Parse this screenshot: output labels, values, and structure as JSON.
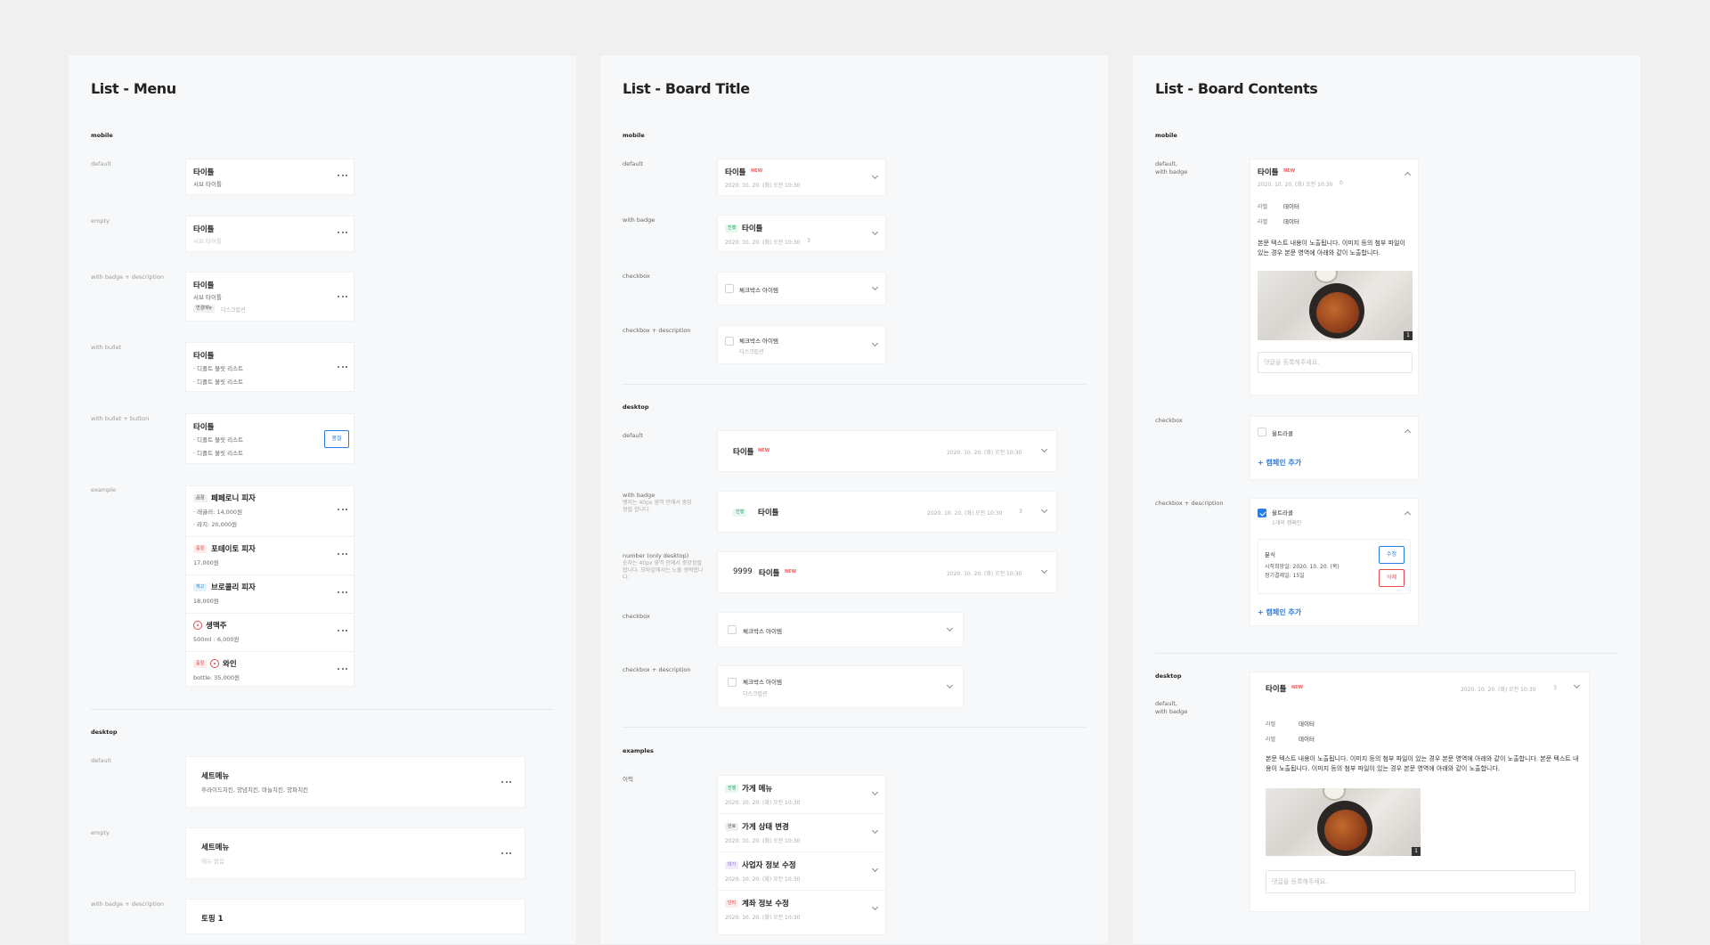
{
  "panels": {
    "menu": {
      "title": "List - Menu",
      "mobile": "mobile",
      "desktop": "desktop",
      "labels": [
        "default",
        "empty",
        "with badge + description",
        "with bullet",
        "with bullet + button",
        "example"
      ],
      "desktop_labels": [
        "default",
        "empty",
        "with badge + description"
      ],
      "title_text": "타이틀",
      "subtitle": "서브 타이틀",
      "badge_desc_badge": "연결메뉴",
      "badge_desc_desc": "디스크립션",
      "bullet1": "· 디폴트 불릿 리스트",
      "bullet2": "· 디폴트 불릿 리스트",
      "button": "품절",
      "example": [
        {
          "badge": "品절",
          "name": "페페로니 피자",
          "lines": [
            "· 레귤러: 14,000원",
            "· 라지: 20,000원"
          ]
        },
        {
          "badge": "품절",
          "name": "포테이토 피자",
          "lines": [
            "17,000원"
          ]
        },
        {
          "badge": "재고",
          "name": "브로콜리 피자",
          "lines": [
            "18,000원"
          ]
        },
        {
          "badge": "",
          "name": "생맥주",
          "lines": [
            "500ml : 6,000원"
          ]
        },
        {
          "badge": "품절",
          "name": "와인",
          "lines": [
            "bottle: 35,000원"
          ]
        }
      ],
      "desk_default_title": "세트메뉴",
      "desk_default_sub": "후라이드치킨, 양념치킨, 마늘치킨, 양파치킨",
      "desk_empty_title": "세트메뉴",
      "desk_empty_sub": "메뉴 없음",
      "desk_badge_title": "토핑 1"
    },
    "board_title": {
      "title": "List - Board Title",
      "mobile": "mobile",
      "desktop": "desktop",
      "examples": "examples",
      "labels": [
        "default",
        "with badge",
        "checkbox",
        "checkbox + description"
      ],
      "desktop_labels": [
        "default",
        "with badge",
        "number (only desktop)",
        "checkbox",
        "checkbox + description"
      ],
      "with_badge_note": "뱃지는 40px 영역 안에서 중앙정렬 합니다.",
      "number_note": "숫자는 40px 영역 안에서 중앙정렬 합니다. 모바일에서는 노출 생략합니다.",
      "history_label": "이력",
      "title_text": "타이틀",
      "new": "NEW",
      "date": "2020. 10. 20. (화) 오전 10:30",
      "comments": "0",
      "comments3": "3",
      "badge_progress": "진행",
      "checkbox_item": "체크박스 아이템",
      "checkbox_desc": "디스크립션",
      "number": "9999",
      "history": [
        {
          "badge": "진행",
          "badge_color": "green",
          "title": "가게 메뉴"
        },
        {
          "badge": "완료",
          "badge_color": "gray",
          "title": "가게 상태 변경"
        },
        {
          "badge": "대기",
          "badge_color": "purple",
          "title": "사업자 정보 수정"
        },
        {
          "badge": "반려",
          "badge_color": "red",
          "title": "계좌 정보 수정"
        }
      ]
    },
    "board_contents": {
      "title": "List - Board Contents",
      "mobile": "mobile",
      "desktop": "desktop",
      "label_default": "default,",
      "label_default2": "with badge",
      "label_checkbox": "checkbox",
      "label_checkbox_desc": "checkbox + description",
      "title_text": "타이틀",
      "new": "NEW",
      "date": "2020. 10. 20. (화) 오전 10:30",
      "comments": "0",
      "comments3": "3",
      "kv_key": "라벨",
      "kv_val": "데이터",
      "body_mobile": "본문 텍스트 내용이 노출됩니다. 이미지 등의 첨부 파일이 있는 경우 본문 영역에 아래와 같이 노출합니다.",
      "body_desktop": "본문 텍스트 내용이 노출됩니다. 이미지 등의 첨부 파일이 있는 경우 본문 영역에 아래와 같이 노출합니다. 본문 텍스트 내용이 노출됩니다. 이미지 등의 첨부 파일이 있는 경우 본문 영역에 아래와 같이 노출합니다.",
      "comment_placeholder": "댓글을 등록해주세요.",
      "checkbox_title": "울트라콜",
      "add_campaign": "+ 캠페인 추가",
      "checked_title": "울트라콜",
      "checked_desc": "1개의 캠페인",
      "campaign_name": "분식",
      "campaign_start": "시작희망일: 2020. 10. 20. (목)",
      "campaign_period": "정기결제일: 15일",
      "edit": "수정",
      "delete": "삭제",
      "image_count": "1"
    }
  }
}
